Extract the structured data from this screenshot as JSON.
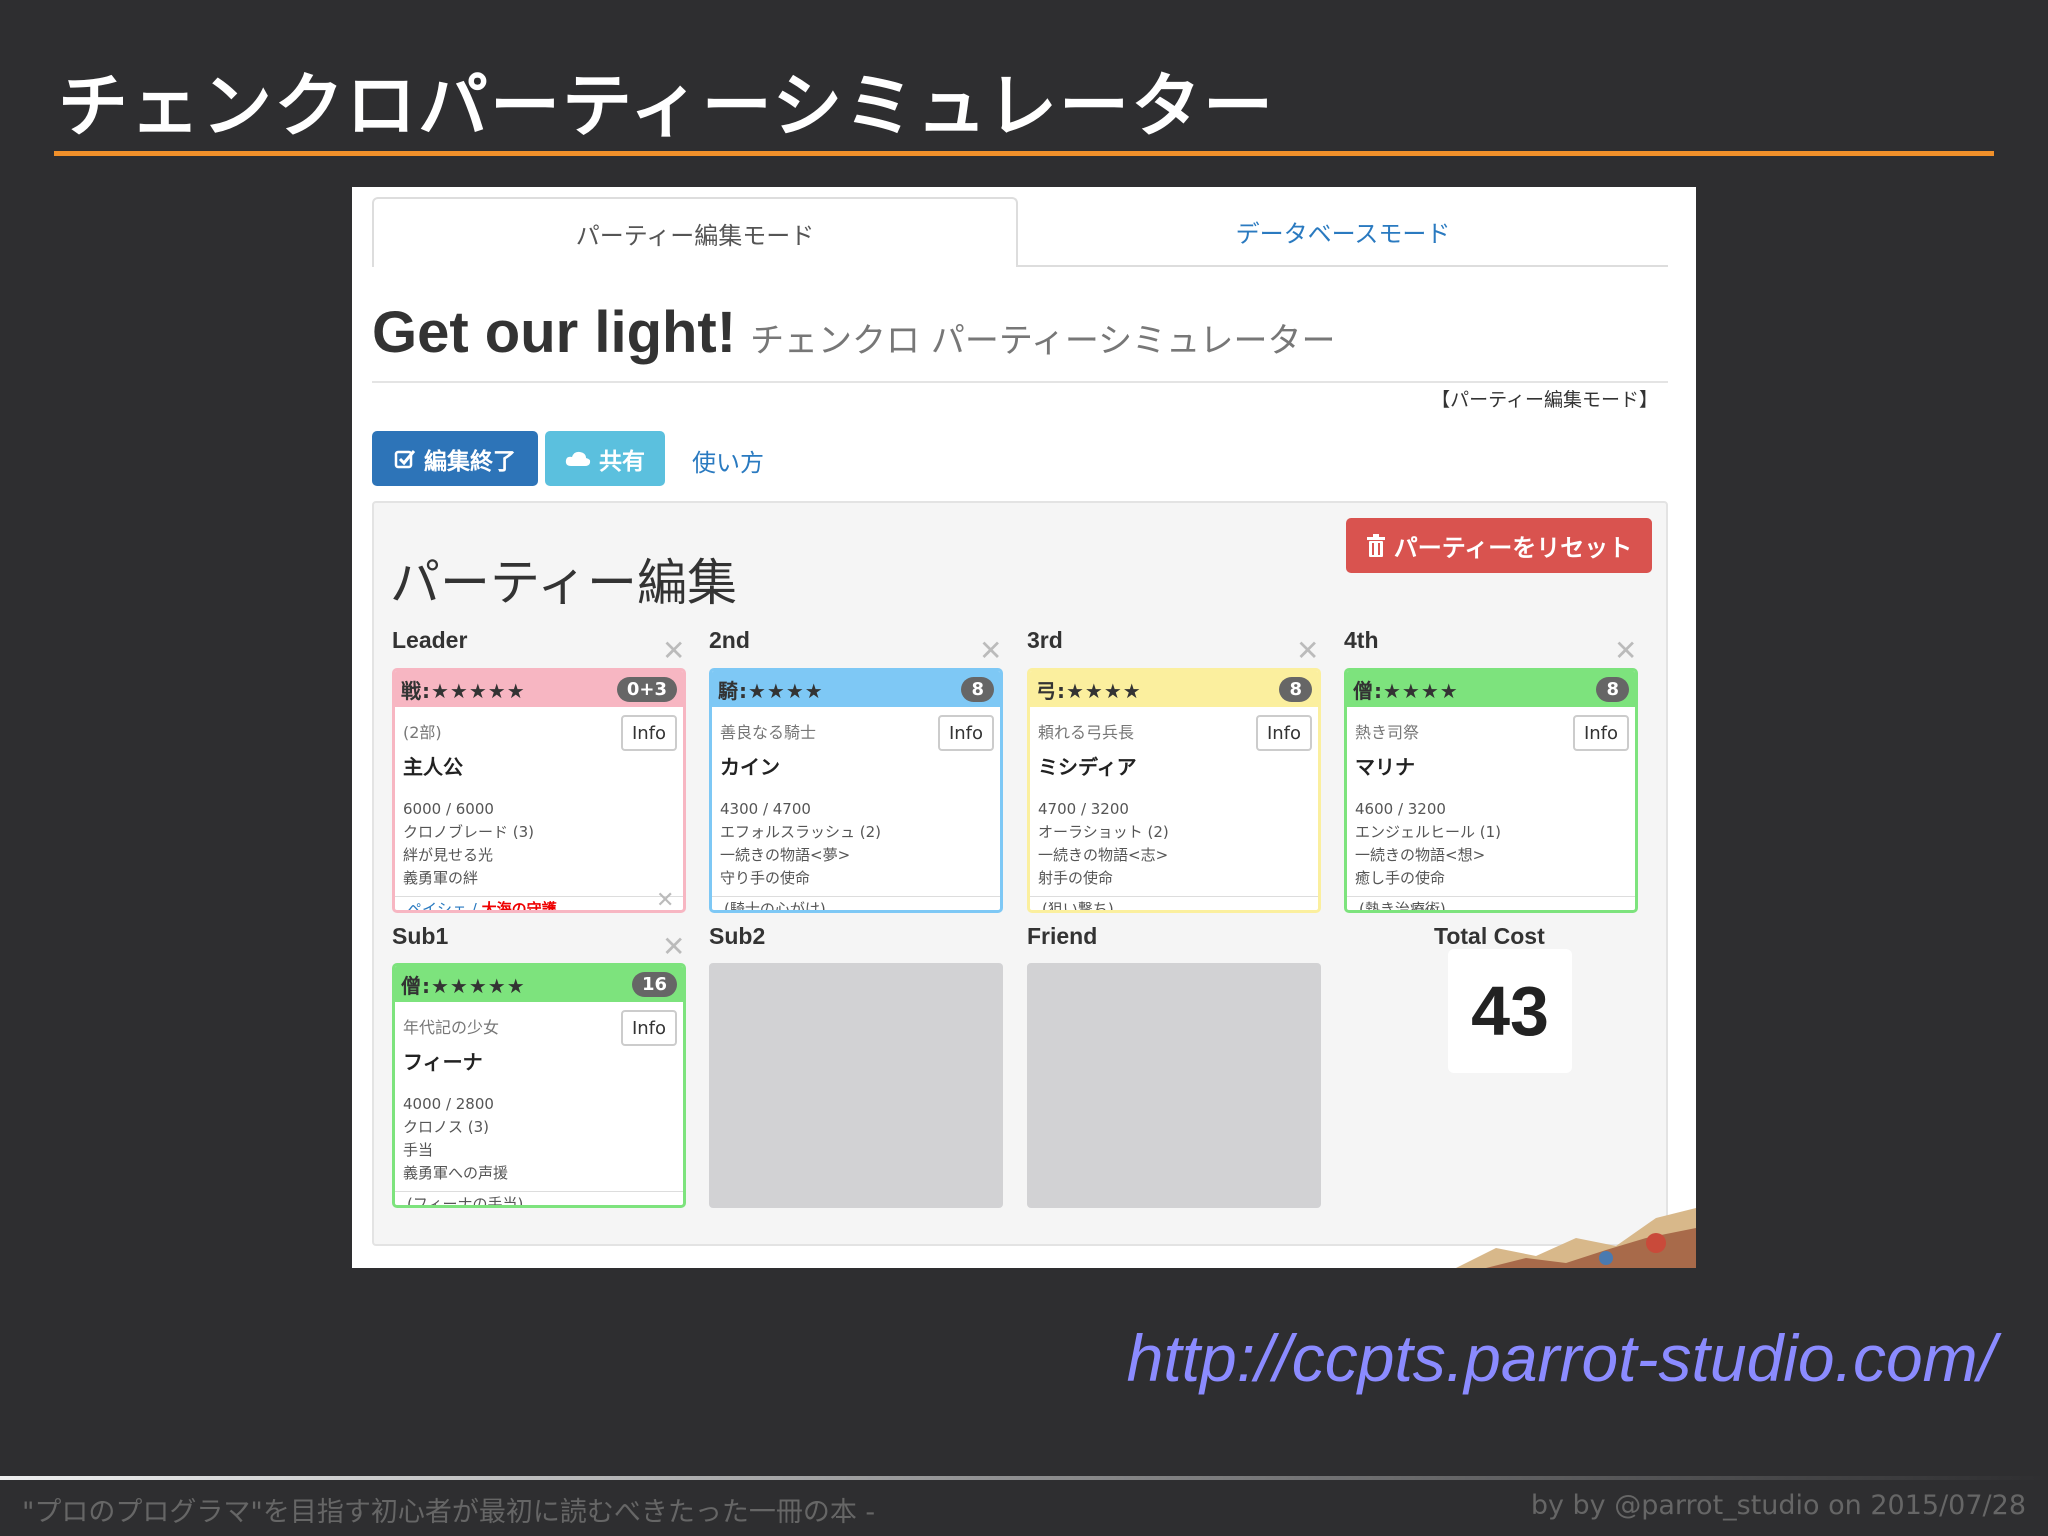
{
  "slide": {
    "title": "チェンクロパーティーシミュレーター",
    "url": "http://ccpts.parrot-studio.com/",
    "footer_left": "\"プロのプログラマ\"を目指す初心者が最初に読むべきたった一冊の本 -",
    "footer_right": "by by @parrot_studio on 2015/07/28"
  },
  "colors": {
    "accent": "#f0902a",
    "primary": "#2d74b8",
    "info": "#5bc0de",
    "danger": "#d9534f"
  },
  "app": {
    "tabs": [
      {
        "label": "パーティー編集モード"
      },
      {
        "label": "データベースモード"
      }
    ],
    "heading": "Get our light!",
    "subheading": "チェンクロ パーティーシミュレーター",
    "mode_label": "【パーティー編集モード】",
    "buttons": {
      "edit_done": "編集終了",
      "share": "共有",
      "how_to": "使い方",
      "reset": "パーティーをリセット"
    },
    "panel_title": "パーティー編集",
    "total_cost_label": "Total Cost",
    "total_cost": "43",
    "slots": [
      {
        "label": "Leader",
        "head": "戦:★★★★★",
        "badge": "0+3",
        "info": "Info",
        "alias": "(2部)",
        "name": "主人公",
        "lines": [
          "6000 / 6000",
          "クロノブレード (3)",
          "絆が見せる光",
          "義勇軍の絆"
        ],
        "last_blue": "ペイシェ / ",
        "last_red": "大海の守護",
        "color": "#f7b6c2"
      },
      {
        "label": "2nd",
        "head": "騎:★★★★",
        "badge": "8",
        "info": "Info",
        "alias": "善良なる騎士",
        "name": "カイン",
        "lines": [
          "4300 / 4700",
          "エフォルスラッシュ (2)",
          "一続きの物語<夢>",
          "守り手の使命"
        ],
        "last": "(騎士の心がけ)",
        "color": "#7ec8f5"
      },
      {
        "label": "3rd",
        "head": "弓:★★★★",
        "badge": "8",
        "info": "Info",
        "alias": "頼れる弓兵長",
        "name": "ミシディア",
        "lines": [
          "4700 / 3200",
          "オーラショット (2)",
          "一続きの物語<志>",
          "射手の使命"
        ],
        "last": "(狙い撃ち)",
        "color": "#fbef9e"
      },
      {
        "label": "4th",
        "head": "僧:★★★★",
        "badge": "8",
        "info": "Info",
        "alias": "熱き司祭",
        "name": "マリナ",
        "lines": [
          "4600 / 3200",
          "エンジェルヒール (1)",
          "一続きの物語<想>",
          "癒し手の使命"
        ],
        "last": "(熱き治療術)",
        "color": "#7de37d"
      },
      {
        "label": "Sub1",
        "head": "僧:★★★★★",
        "badge": "16",
        "info": "Info",
        "alias": "年代記の少女",
        "name": "フィーナ",
        "lines": [
          "4000 / 2800",
          "クロノス (3)",
          "手当",
          "義勇軍への声援"
        ],
        "last": "(フィーナの手当)",
        "color": "#7de37d"
      },
      {
        "label": "Sub2"
      },
      {
        "label": "Friend"
      }
    ]
  }
}
